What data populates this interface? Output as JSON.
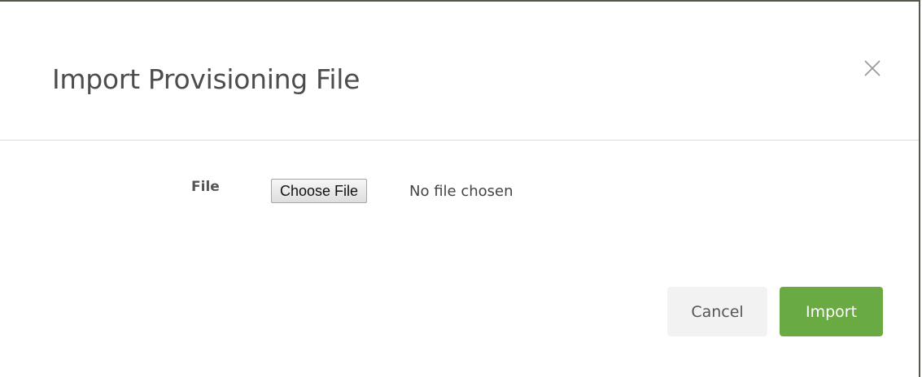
{
  "dialog": {
    "title": "Import Provisioning File",
    "close_icon": "close-icon"
  },
  "form": {
    "file_label": "File",
    "choose_file_label": "Choose File",
    "file_status": "No file chosen"
  },
  "footer": {
    "cancel_label": "Cancel",
    "import_label": "Import"
  },
  "colors": {
    "primary": "#6aaa42",
    "cancel_bg": "#f2f2f2",
    "title_text": "#4d4d4d"
  }
}
